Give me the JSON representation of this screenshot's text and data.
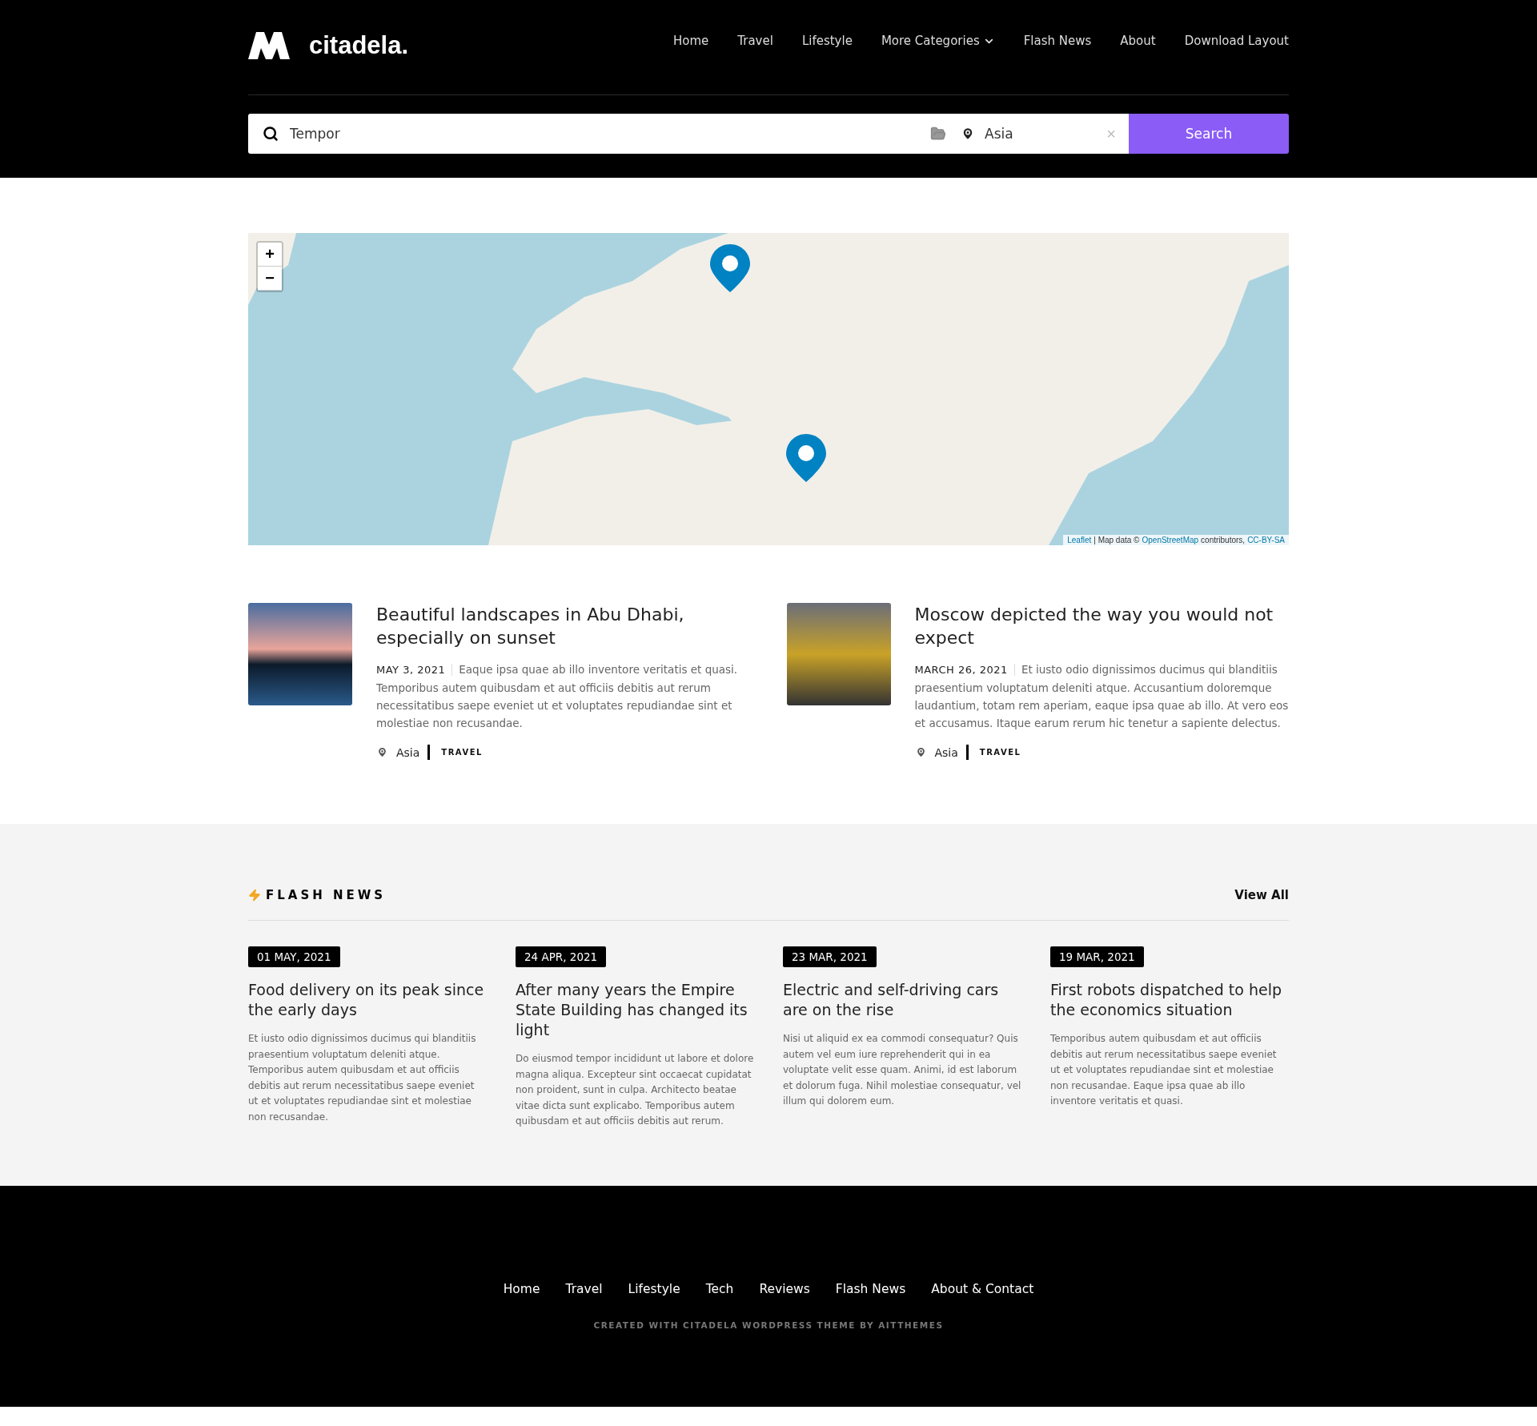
{
  "header": {
    "logo": "citadela.",
    "nav": [
      {
        "label": "Home",
        "dropdown": false
      },
      {
        "label": "Travel",
        "dropdown": false
      },
      {
        "label": "Lifestyle",
        "dropdown": false
      },
      {
        "label": "More Categories",
        "dropdown": true
      },
      {
        "label": "Flash News",
        "dropdown": false
      },
      {
        "label": "About",
        "dropdown": false
      },
      {
        "label": "Download Layout",
        "dropdown": false
      }
    ]
  },
  "search": {
    "keyword": "Tempor",
    "location": "Asia",
    "clear": "×",
    "button": "Search"
  },
  "map": {
    "zoom_in": "+",
    "zoom_out": "−",
    "attribution": {
      "leaflet": "Leaflet",
      "data": "| Map data ©",
      "osm": "OpenStreetMap",
      "contributors": "contributors,",
      "license": "CC-BY-SA"
    }
  },
  "articles": [
    {
      "title": "Beautiful landscapes in Abu Dhabi, especially on sunset",
      "date": "MAY 3, 2021",
      "excerpt": "Eaque ipsa quae ab illo inventore veritatis et quasi. Temporibus autem quibusdam et aut officiis debitis aut rerum necessitatibus saepe eveniet ut et voluptates repudiandae sint et molestiae non recusandae.",
      "location": "Asia",
      "category": "TRAVEL"
    },
    {
      "title": "Moscow depicted the way you would not expect",
      "date": "MARCH 26, 2021",
      "excerpt": "Et iusto odio dignissimos ducimus qui blanditiis praesentium voluptatum deleniti atque. Accusantium doloremque laudantium, totam rem aperiam, eaque ipsa quae ab illo. At vero eos et accusamus. Itaque earum rerum hic tenetur a sapiente delectus.",
      "location": "Asia",
      "category": "TRAVEL"
    }
  ],
  "flash_news": {
    "title": "FLASH NEWS",
    "view_all": "View All",
    "items": [
      {
        "date": "01 MAY, 2021",
        "title": "Food delivery on its peak since the early days",
        "excerpt": "Et iusto odio dignissimos ducimus qui blanditiis praesentium voluptatum deleniti atque. Temporibus autem quibusdam et aut officiis debitis aut rerum necessitatibus saepe eveniet ut et voluptates repudiandae sint et molestiae non recusandae."
      },
      {
        "date": "24 APR, 2021",
        "title": "After many years the Empire State Building has changed its light",
        "excerpt": "Do eiusmod tempor incididunt ut labore et dolore magna aliqua. Excepteur sint occaecat cupidatat non proident, sunt in culpa. Architecto beatae vitae dicta sunt explicabo. Temporibus autem quibusdam et aut officiis debitis aut rerum."
      },
      {
        "date": "23 MAR, 2021",
        "title": "Electric and self-driving cars are on the rise",
        "excerpt": "Nisi ut aliquid ex ea commodi consequatur? Quis autem vel eum iure reprehenderit qui in ea voluptate velit esse quam. Animi, id est laborum et dolorum fuga. Nihil molestiae consequatur, vel illum qui dolorem eum."
      },
      {
        "date": "19 MAR, 2021",
        "title": "First robots dispatched to help the economics situation",
        "excerpt": "Temporibus autem quibusdam et aut officiis debitis aut rerum necessitatibus saepe eveniet ut et voluptates repudiandae sint et molestiae non recusandae. Eaque ipsa quae ab illo inventore veritatis et quasi."
      }
    ]
  },
  "footer": {
    "nav": [
      "Home",
      "Travel",
      "Lifestyle",
      "Tech",
      "Reviews",
      "Flash News",
      "About & Contact"
    ],
    "credit": "CREATED WITH CITADELA WORDPRESS THEME BY AITTHEMES"
  }
}
